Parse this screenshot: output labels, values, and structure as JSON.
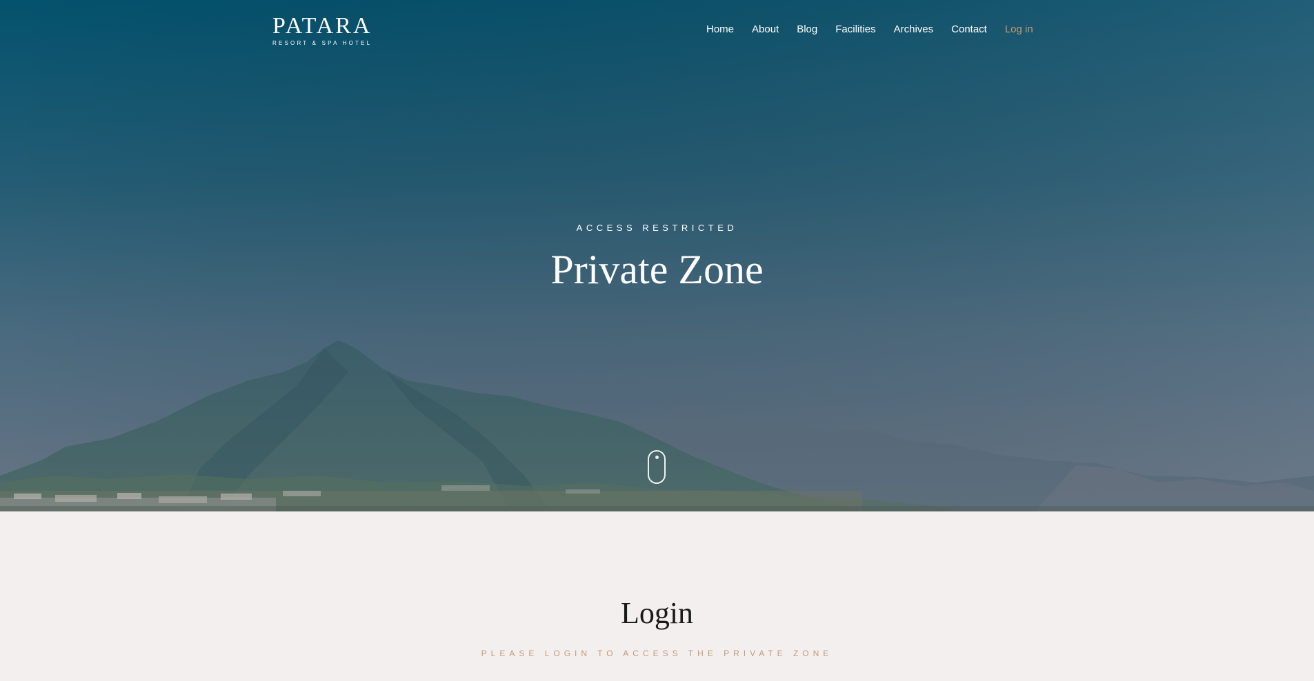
{
  "header": {
    "brand_name": "PATARA",
    "brand_tagline": "RESORT & SPA HOTEL",
    "nav": {
      "home": "Home",
      "about": "About",
      "blog": "Blog",
      "facilities": "Facilities",
      "archives": "Archives",
      "contact": "Contact",
      "login": "Log in"
    }
  },
  "hero": {
    "kicker": "ACCESS RESTRICTED",
    "title": "Private Zone",
    "scroll_icon": "mouse-scroll-icon"
  },
  "login": {
    "title": "Login",
    "subtitle": "PLEASE LOGIN TO ACCESS THE PRIVATE ZONE"
  },
  "colors": {
    "accent": "#c39a74",
    "hero_top": "#05536f",
    "section_bg": "#f4efef",
    "text_dark": "#1a1a1a"
  }
}
